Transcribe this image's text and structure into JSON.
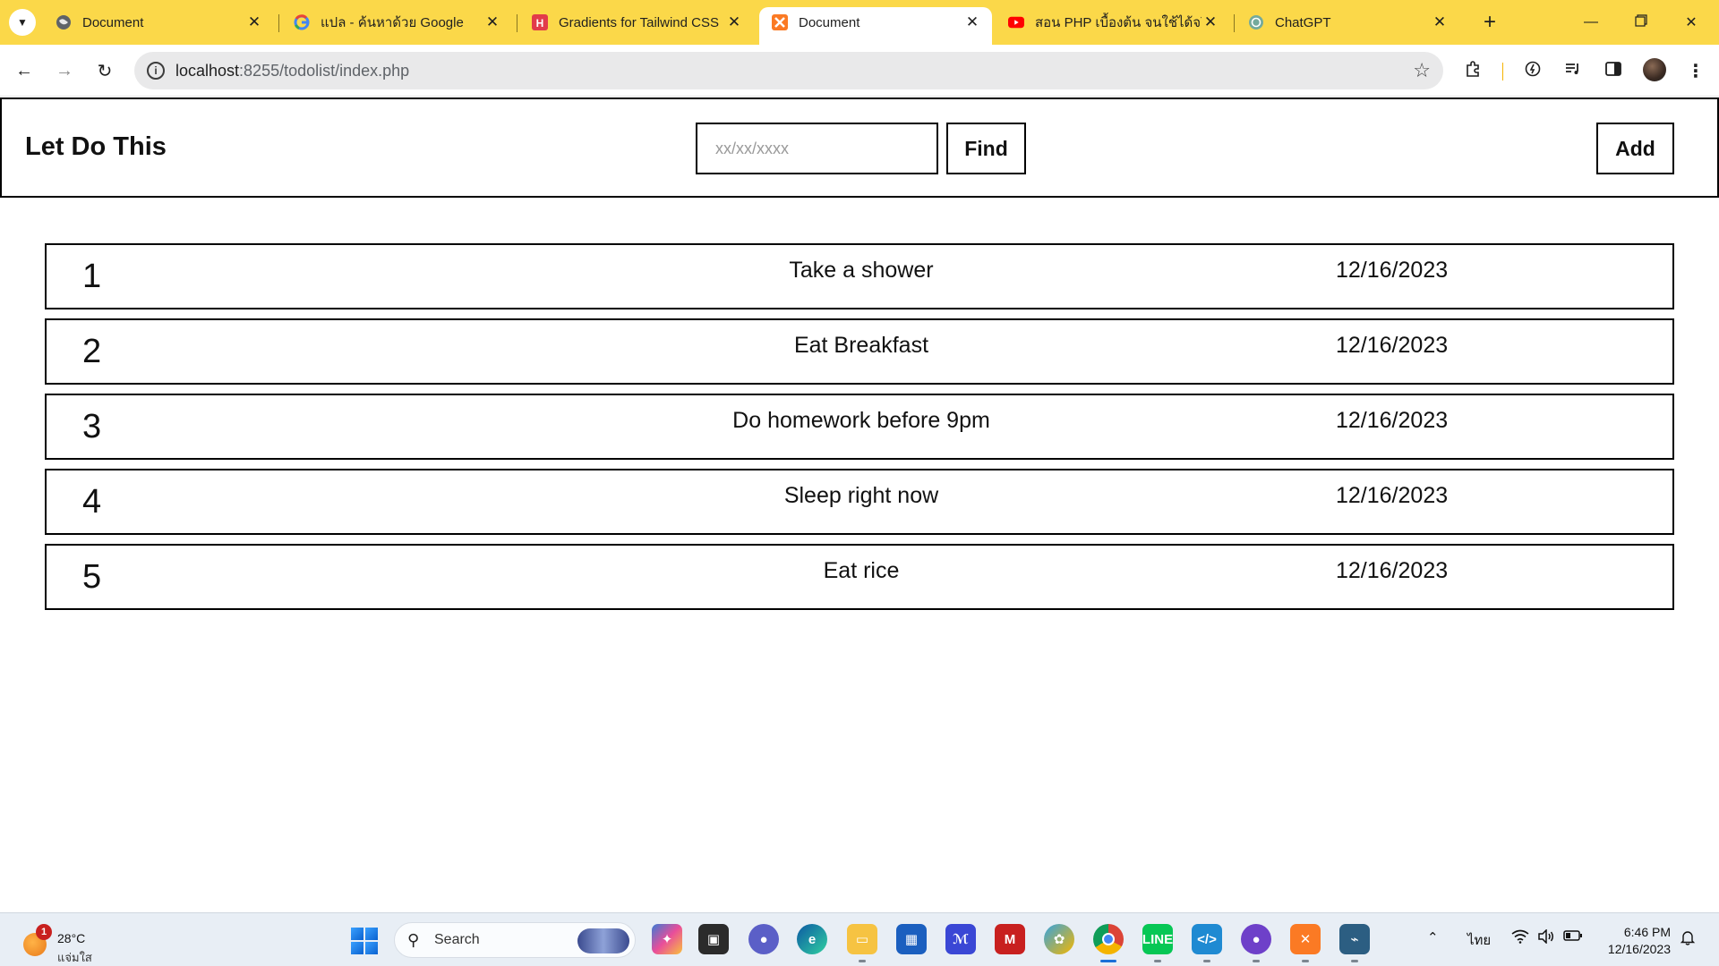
{
  "browser": {
    "tabs": [
      {
        "title": "Document",
        "favicon": "globe-icon",
        "active": false
      },
      {
        "title": "แปล - ค้นหาด้วย Google",
        "favicon": "google-icon",
        "active": false
      },
      {
        "title": "Gradients for Tailwind CSS",
        "favicon": "hypercolor-icon",
        "active": false
      },
      {
        "title": "Document",
        "favicon": "xampp-icon",
        "active": true
      },
      {
        "title": "สอน PHP เบื้องต้น จนใช้ได้จริง",
        "favicon": "youtube-icon",
        "active": false
      },
      {
        "title": "ChatGPT",
        "favicon": "chatgpt-icon",
        "active": false
      }
    ],
    "url_host": "localhost",
    "url_path": ":8255/todolist/index.php"
  },
  "app": {
    "title": "Let Do This",
    "search_placeholder": "xx/xx/xxxx",
    "search_value": "",
    "find_label": "Find",
    "add_label": "Add"
  },
  "todos": [
    {
      "num": "1",
      "text": "Take a shower",
      "date": "12/16/2023"
    },
    {
      "num": "2",
      "text": "Eat Breakfast",
      "date": "12/16/2023"
    },
    {
      "num": "3",
      "text": "Do homework before 9pm",
      "date": "12/16/2023"
    },
    {
      "num": "4",
      "text": "Sleep right now",
      "date": "12/16/2023"
    },
    {
      "num": "5",
      "text": "Eat rice",
      "date": "12/16/2023"
    }
  ],
  "taskbar": {
    "weather_temp": "28°C",
    "weather_desc": "แจ่มใส",
    "weather_badge": "1",
    "search_label": "Search",
    "language": "ไทย",
    "time": "6:46 PM",
    "date": "12/16/2023"
  },
  "colors": {
    "tabstrip": "#fbd849",
    "accent_blue": "#1a6fd8"
  }
}
